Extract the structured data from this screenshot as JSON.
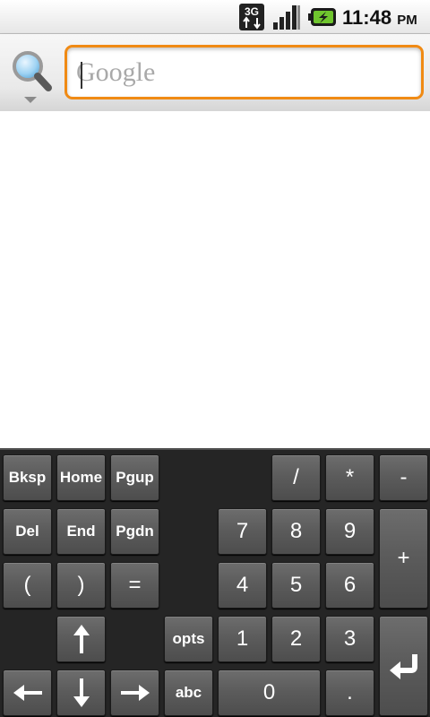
{
  "status_bar": {
    "network_type": "3G",
    "network_icon": "3g-data-icon",
    "signal_icon": "signal-strength-icon",
    "battery_icon": "battery-charging-icon",
    "time": "11:48",
    "ampm": "PM"
  },
  "search": {
    "engine_icon": "magnifier-icon",
    "placeholder": "Google",
    "value": "",
    "accent_color": "#f08a14"
  },
  "keypad": {
    "keys": {
      "bksp": "Bksp",
      "home": "Home",
      "pgup": "Pgup",
      "divide": "/",
      "multiply": "*",
      "minus": "-",
      "del": "Del",
      "end": "End",
      "pgdn": "Pgdn",
      "seven": "7",
      "eight": "8",
      "nine": "9",
      "plus": "+",
      "lparen": "(",
      "rparen": ")",
      "equals": "=",
      "four": "4",
      "five": "5",
      "six": "6",
      "opts": "opts",
      "one": "1",
      "two": "2",
      "three": "3",
      "abc": "abc",
      "zero": "0",
      "dot": "."
    },
    "icons": {
      "up": "arrow-up-icon",
      "down": "arrow-down-icon",
      "left": "arrow-left-icon",
      "right": "arrow-right-icon",
      "enter": "enter-return-icon"
    }
  }
}
